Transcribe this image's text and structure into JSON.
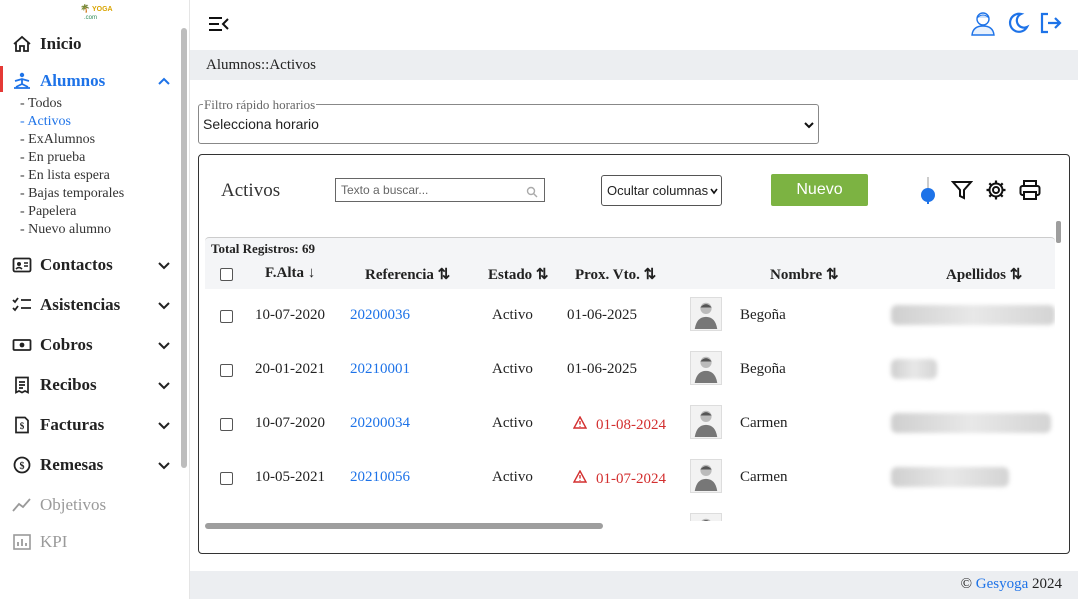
{
  "brand": {
    "logo_top": "YOGA",
    "logo_mid": "X",
    "logo_bottom": ".com"
  },
  "sidebar": {
    "items": [
      {
        "label": "Inicio",
        "icon": "home-icon"
      },
      {
        "label": "Alumnos",
        "icon": "yoga-icon",
        "active": true
      },
      {
        "label": "Contactos",
        "icon": "contact-card-icon"
      },
      {
        "label": "Asistencias",
        "icon": "checklist-icon"
      },
      {
        "label": "Cobros",
        "icon": "money-icon"
      },
      {
        "label": "Recibos",
        "icon": "receipt-icon"
      },
      {
        "label": "Facturas",
        "icon": "invoice-icon"
      },
      {
        "label": "Remesas",
        "icon": "currency-exchange-icon"
      },
      {
        "label": "Objetivos",
        "icon": "trend-icon"
      },
      {
        "label": "KPI",
        "icon": "bar-chart-icon"
      }
    ],
    "alumnos_sub": [
      "- Todos",
      "- Activos",
      "- ExAlumnos",
      "- En prueba",
      "- En lista espera",
      "- Bajas temporales",
      "- Papelera",
      "- Nuevo alumno"
    ]
  },
  "breadcrumb": "Alumnos::Activos",
  "filter": {
    "legend": "Filtro rápido horarios",
    "value": "Selecciona horario"
  },
  "panel": {
    "title": "Activos",
    "search_placeholder": "Texto a buscar...",
    "hide_columns": "Ocultar columnas",
    "new_button": "Nuevo",
    "total": "Total Registros: 69"
  },
  "table": {
    "headers": [
      "F.Alta ↓",
      "Referencia ⇅",
      "Estado ⇅",
      "Prox. Vto. ⇅",
      "Nombre ⇅",
      "Apellidos ⇅"
    ],
    "rows": [
      {
        "alta": "10-07-2020",
        "ref": "20200036",
        "estado": "Activo",
        "vto": "01-06-2025",
        "vto_warn": false,
        "nombre": "Begoña"
      },
      {
        "alta": "20-01-2021",
        "ref": "20210001",
        "estado": "Activo",
        "vto": "01-06-2025",
        "vto_warn": false,
        "nombre": "Begoña"
      },
      {
        "alta": "10-07-2020",
        "ref": "20200034",
        "estado": "Activo",
        "vto": "01-08-2024",
        "vto_warn": true,
        "nombre": "Carmen"
      },
      {
        "alta": "10-05-2021",
        "ref": "20210056",
        "estado": "Activo",
        "vto": "01-07-2024",
        "vto_warn": true,
        "nombre": "Carmen"
      }
    ]
  },
  "footer": {
    "copy": "©",
    "brand": "Gesyoga",
    "year": "2024"
  },
  "colors": {
    "accent": "#1e73e8",
    "new_button": "#7cb342",
    "warn": "#d32f2f",
    "active_bar": "#e53935"
  }
}
